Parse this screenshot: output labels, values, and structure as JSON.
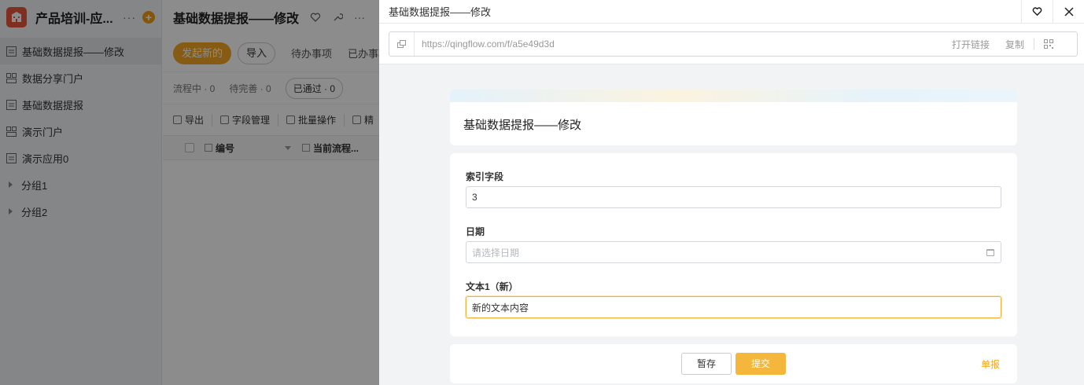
{
  "app": {
    "name": "产品培训-应...",
    "more": "···",
    "add": "+"
  },
  "sidebar": {
    "items": [
      {
        "label": "基础数据提报——修改",
        "icon": "form-icon"
      },
      {
        "label": "数据分享门户",
        "icon": "portal-icon"
      },
      {
        "label": "基础数据提报",
        "icon": "form-icon"
      },
      {
        "label": "演示门户",
        "icon": "portal-icon"
      },
      {
        "label": "演示应用0",
        "icon": "form-icon"
      },
      {
        "label": "分组1",
        "icon": "caret-right-icon"
      },
      {
        "label": "分组2",
        "icon": "caret-right-icon"
      }
    ]
  },
  "main": {
    "title": "基础数据提报——修改",
    "more": "···",
    "toolbar": {
      "new_label": "发起新的",
      "import_label": "导入",
      "todo_label": "待办事项",
      "done_label": "已办事项"
    },
    "filters": [
      "流程中 · 0",
      "待完善 · 0",
      "已通过 · 0"
    ],
    "tools": [
      "导出",
      "字段管理",
      "批量操作",
      "精"
    ],
    "columns": [
      "编号",
      "当前流程..."
    ]
  },
  "drawer": {
    "title": "基础数据提报——修改",
    "url": "https://qingflow.com/f/a5e49d3d",
    "open_link": "打开链接",
    "copy": "复制",
    "form_title": "基础数据提报——修改",
    "fields": [
      {
        "label": "索引字段",
        "value": "3",
        "placeholder": ""
      },
      {
        "label": "日期",
        "value": "",
        "placeholder": "请选择日期"
      },
      {
        "label": "文本1（新）",
        "value": "新的文本内容",
        "placeholder": ""
      }
    ],
    "save_label": "暂存",
    "submit_label": "提交",
    "single_report": "单报"
  },
  "colors": {
    "accent": "#f5a623",
    "submit": "#f5b73b",
    "logo": "#e8553c"
  }
}
